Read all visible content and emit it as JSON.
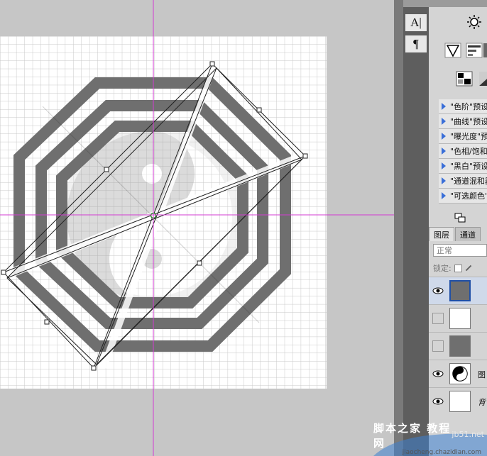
{
  "tools": {
    "text_tool_glyph": "A|",
    "paragraph_tool_glyph": "¶"
  },
  "adjustments": {
    "icons": [
      "brightness-icon",
      "vibrance-icon",
      "levels-icon",
      "gradient-icon",
      "selective-color-icon"
    ],
    "presets": [
      {
        "label": "\"色阶\"预设"
      },
      {
        "label": "\"曲线\"预设"
      },
      {
        "label": "\"曝光度\"预设"
      },
      {
        "label": "\"色相/饱和度\"预设"
      },
      {
        "label": "\"黑白\"预设"
      },
      {
        "label": "\"通道混和器\"预设"
      },
      {
        "label": "\"可选颜色\"预设"
      }
    ]
  },
  "layers_panel": {
    "tabs": [
      "图层",
      "通道"
    ],
    "blend_mode": "正常",
    "lock_label": "锁定:",
    "layers": [
      {
        "name": "",
        "visible": true,
        "thumb": "gray"
      },
      {
        "name": "",
        "visible": false,
        "thumb": "white"
      },
      {
        "name": "",
        "visible": false,
        "thumb": "gray"
      },
      {
        "name": "图",
        "visible": true,
        "thumb": "yinyang"
      },
      {
        "name": "背",
        "visible": true,
        "thumb": "white"
      }
    ]
  },
  "watermark": {
    "main": "脚本之家 教程网",
    "url": "jb51.net",
    "sub": "jiaocheng.chazidian.com"
  },
  "colors": {
    "guide": "#d33bd3",
    "shape": "#6f6f6f",
    "grid": "#c9c9c9",
    "preset_arrow": "#3a6fd8"
  }
}
